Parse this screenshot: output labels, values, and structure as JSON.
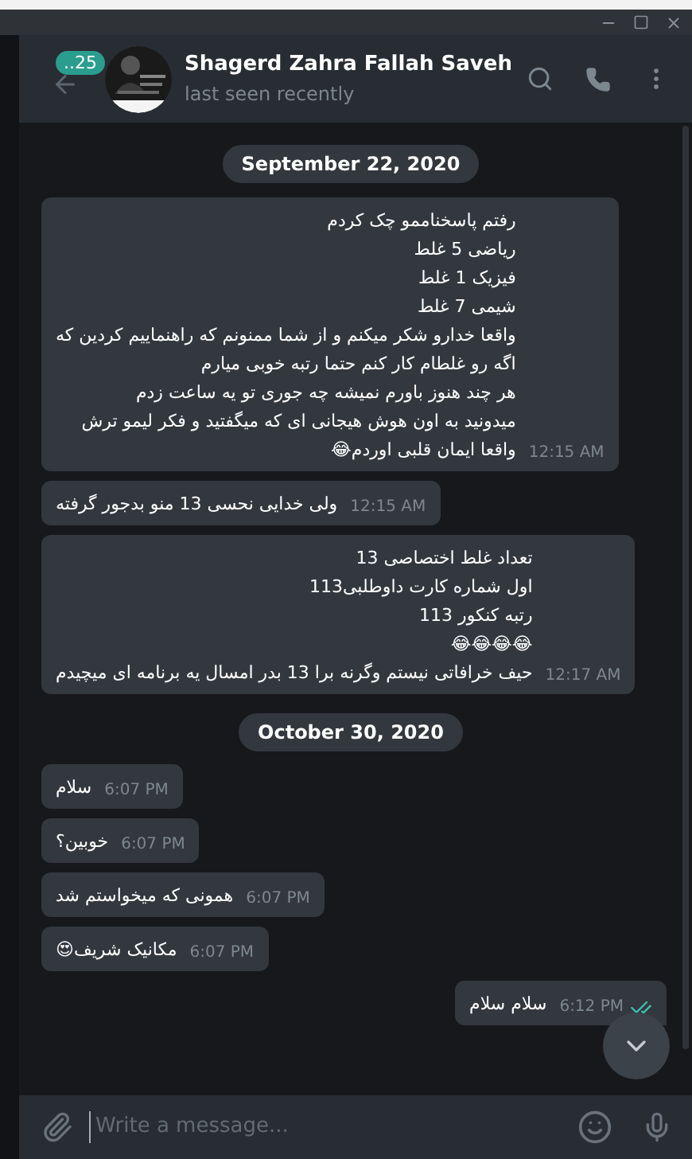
{
  "header": {
    "unread_badge": "..25",
    "name": "Shagerd Zahra Fallah Saveh",
    "status": "last seen recently"
  },
  "groups": [
    {
      "date": "September 22, 2020",
      "messages": [
        {
          "kind": "incoming",
          "lines": [
            "رفتم پاسخناممو چک کردم",
            "ریاضی 5 غلط",
            "فیزیک 1 غلط",
            "شیمی 7 غلط",
            "واقعا خدارو شکر میکنم و از شما ممنونم که راهنماییم کردین که",
            "اگه رو غلطام کار کنم حتما رتبه خوبی میارم",
            "هر چند هنوز باورم نمیشه چه جوری تو یه ساعت زدم",
            "میدونید به اون هوش هیجانی ای که میگفتید و فکر لیمو ترش",
            "واقعا ایمان قلبی اوردم😂"
          ],
          "time": "12:15 AM"
        },
        {
          "kind": "incoming",
          "lines": [
            "ولی خدایی نحسی 13 منو بدجور گرفته"
          ],
          "time": "12:15 AM"
        },
        {
          "kind": "incoming",
          "lines": [
            "تعداد غلط اختصاصی 13",
            "اول شماره کارت داوطلبی113",
            "رتبه کنکور 113",
            "😂😂😂😂",
            "حیف خرافاتی نیستم وگرنه برا 13 بدر امسال یه برنامه ای میچیدم"
          ],
          "time": "12:17 AM"
        }
      ]
    },
    {
      "date": "October 30, 2020",
      "messages": [
        {
          "kind": "incoming",
          "lines": [
            "سلام"
          ],
          "time": "6:07 PM"
        },
        {
          "kind": "incoming",
          "lines": [
            "خوبین؟"
          ],
          "time": "6:07 PM"
        },
        {
          "kind": "incoming",
          "lines": [
            "همونی که میخواستم شد"
          ],
          "time": "6:07 PM"
        },
        {
          "kind": "incoming",
          "lines": [
            "مکانیک شریف😍"
          ],
          "time": "6:07 PM"
        },
        {
          "kind": "outgoing",
          "lines": [
            "سلام سلام"
          ],
          "time": "6:12 PM",
          "read": true
        }
      ]
    }
  ],
  "composer": {
    "placeholder": "Write a message..."
  }
}
